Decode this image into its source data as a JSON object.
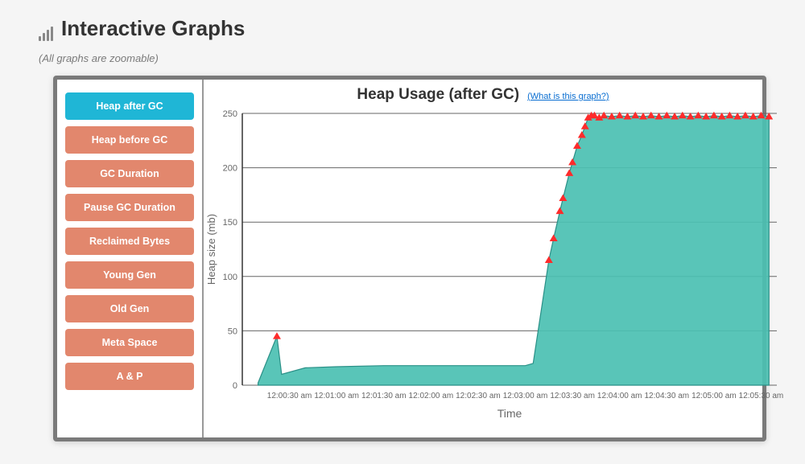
{
  "heading": "Interactive Graphs",
  "subtitle": "(All graphs are zoomable)",
  "sidebar": {
    "items": [
      {
        "label": "Heap after GC",
        "active": true
      },
      {
        "label": "Heap before GC",
        "active": false
      },
      {
        "label": "GC Duration",
        "active": false
      },
      {
        "label": "Pause GC Duration",
        "active": false
      },
      {
        "label": "Reclaimed Bytes",
        "active": false
      },
      {
        "label": "Young Gen",
        "active": false
      },
      {
        "label": "Old Gen",
        "active": false
      },
      {
        "label": "Meta Space",
        "active": false
      },
      {
        "label": "A & P",
        "active": false
      }
    ]
  },
  "chart": {
    "title": "Heap Usage (after GC)",
    "whatLink": "(What is this graph?)",
    "xlabel": "Time",
    "ylabel": "Heap size (mb)"
  },
  "icon_bars_heights": [
    6,
    10,
    14,
    18
  ],
  "colors": {
    "active_tab": "#1fb6d6",
    "inactive_tab": "#e2876d",
    "area_fill": "#4bc0b2",
    "marker": "#ff2b2b",
    "panel_border": "#7a7a7a"
  },
  "chart_data": {
    "type": "area",
    "title": "Heap Usage (after GC)",
    "xlabel": "Time",
    "ylabel": "Heap size (mb)",
    "ylim": [
      0,
      250
    ],
    "y_ticks": [
      0,
      50,
      100,
      150,
      200,
      250
    ],
    "x_ticks": [
      "12:00:30 am",
      "12:01:00 am",
      "12:01:30 am",
      "12:02:00 am",
      "12:02:30 am",
      "12:03:00 am",
      "12:03:30 am",
      "12:04:00 am",
      "12:04:30 am",
      "12:05:00 am",
      "12:05:30 am"
    ],
    "series": [
      {
        "name": "Heap after GC",
        "points": [
          {
            "x": "12:00:10 am",
            "y": 2
          },
          {
            "x": "12:00:22 am",
            "y": 45,
            "marker": true
          },
          {
            "x": "12:00:25 am",
            "y": 10
          },
          {
            "x": "12:00:40 am",
            "y": 16
          },
          {
            "x": "12:01:00 am",
            "y": 17
          },
          {
            "x": "12:01:30 am",
            "y": 18
          },
          {
            "x": "12:02:00 am",
            "y": 18
          },
          {
            "x": "12:02:30 am",
            "y": 18
          },
          {
            "x": "12:03:00 am",
            "y": 18
          },
          {
            "x": "12:03:05 am",
            "y": 20
          },
          {
            "x": "12:03:15 am",
            "y": 115,
            "marker": true
          },
          {
            "x": "12:03:18 am",
            "y": 135,
            "marker": true
          },
          {
            "x": "12:03:22 am",
            "y": 160,
            "marker": true
          },
          {
            "x": "12:03:24 am",
            "y": 172,
            "marker": true
          },
          {
            "x": "12:03:28 am",
            "y": 195,
            "marker": true
          },
          {
            "x": "12:03:30 am",
            "y": 205,
            "marker": true
          },
          {
            "x": "12:03:33 am",
            "y": 220,
            "marker": true
          },
          {
            "x": "12:03:36 am",
            "y": 230,
            "marker": true
          },
          {
            "x": "12:03:38 am",
            "y": 238,
            "marker": true
          },
          {
            "x": "12:03:40 am",
            "y": 246,
            "marker": true
          },
          {
            "x": "12:03:42 am",
            "y": 248,
            "marker": true
          },
          {
            "x": "12:03:44 am",
            "y": 248,
            "marker": true
          },
          {
            "x": "12:03:47 am",
            "y": 246,
            "marker": true
          },
          {
            "x": "12:03:50 am",
            "y": 248,
            "marker": true
          },
          {
            "x": "12:03:55 am",
            "y": 247,
            "marker": true
          },
          {
            "x": "12:04:00 am",
            "y": 248,
            "marker": true
          },
          {
            "x": "12:04:05 am",
            "y": 247,
            "marker": true
          },
          {
            "x": "12:04:10 am",
            "y": 248,
            "marker": true
          },
          {
            "x": "12:04:15 am",
            "y": 247,
            "marker": true
          },
          {
            "x": "12:04:20 am",
            "y": 248,
            "marker": true
          },
          {
            "x": "12:04:25 am",
            "y": 247,
            "marker": true
          },
          {
            "x": "12:04:30 am",
            "y": 248,
            "marker": true
          },
          {
            "x": "12:04:35 am",
            "y": 247,
            "marker": true
          },
          {
            "x": "12:04:40 am",
            "y": 248,
            "marker": true
          },
          {
            "x": "12:04:45 am",
            "y": 247,
            "marker": true
          },
          {
            "x": "12:04:50 am",
            "y": 248,
            "marker": true
          },
          {
            "x": "12:04:55 am",
            "y": 247,
            "marker": true
          },
          {
            "x": "12:05:00 am",
            "y": 248,
            "marker": true
          },
          {
            "x": "12:05:05 am",
            "y": 247,
            "marker": true
          },
          {
            "x": "12:05:10 am",
            "y": 248,
            "marker": true
          },
          {
            "x": "12:05:15 am",
            "y": 247,
            "marker": true
          },
          {
            "x": "12:05:20 am",
            "y": 248,
            "marker": true
          },
          {
            "x": "12:05:25 am",
            "y": 247,
            "marker": true
          },
          {
            "x": "12:05:30 am",
            "y": 248,
            "marker": true
          },
          {
            "x": "12:05:35 am",
            "y": 247,
            "marker": true
          }
        ]
      }
    ]
  }
}
